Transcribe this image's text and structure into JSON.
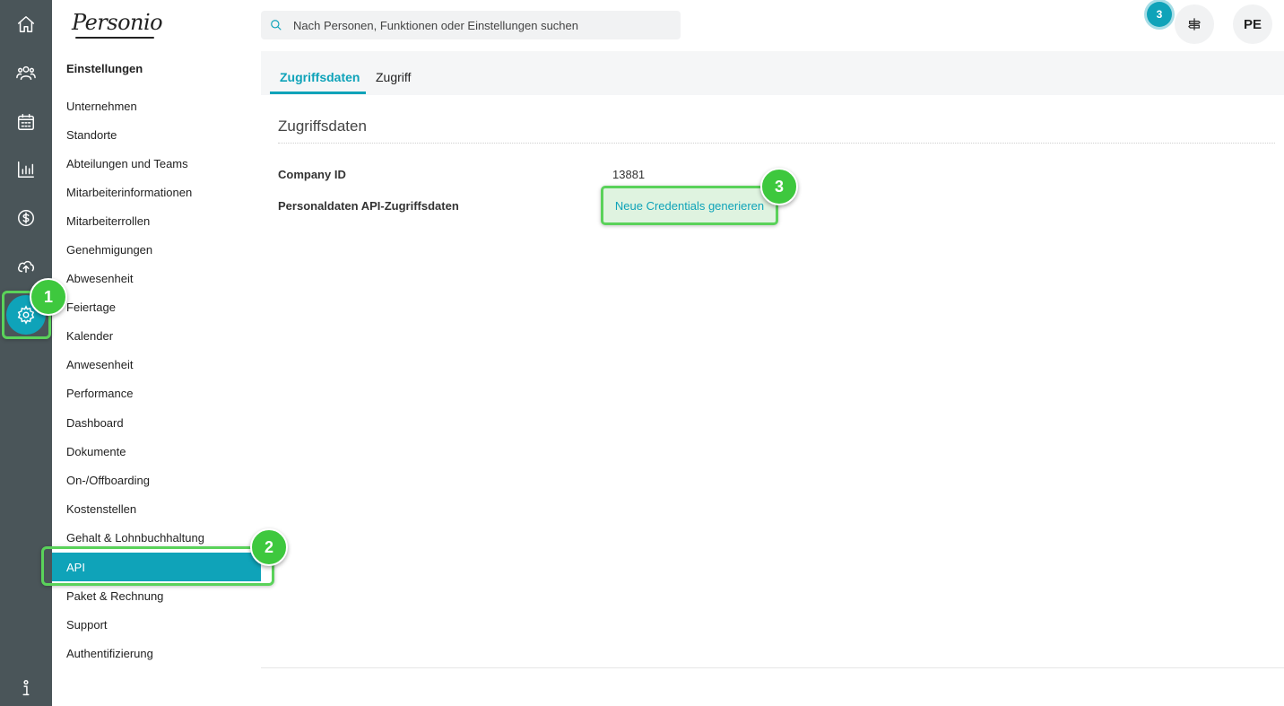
{
  "header": {
    "logo_text": "Personio",
    "search_placeholder": "Nach Personen, Funktionen oder Einstellungen suchen",
    "notification_count": "3",
    "avatar_initials": "PE"
  },
  "rail": {
    "icons": [
      "home-icon",
      "people-icon",
      "calendar-icon",
      "chart-icon",
      "dollar-icon",
      "cloud-upload-icon",
      "gear-icon",
      "info-icon"
    ]
  },
  "settings_nav": {
    "title": "Einstellungen",
    "items": [
      {
        "label": "Unternehmen"
      },
      {
        "label": "Standorte"
      },
      {
        "label": "Abteilungen und Teams"
      },
      {
        "label": "Mitarbeiterinformationen"
      },
      {
        "label": "Mitarbeiterrollen"
      },
      {
        "label": "Genehmigungen"
      },
      {
        "label": "Abwesenheit"
      },
      {
        "label": "Feiertage"
      },
      {
        "label": "Kalender"
      },
      {
        "label": "Anwesenheit"
      },
      {
        "label": "Performance"
      },
      {
        "label": "Dashboard"
      },
      {
        "label": "Dokumente"
      },
      {
        "label": "On-/Offboarding"
      },
      {
        "label": "Kostenstellen"
      },
      {
        "label": "Gehalt & Lohnbuchhaltung"
      },
      {
        "label": "API",
        "active": true
      },
      {
        "label": "Paket & Rechnung"
      },
      {
        "label": "Support"
      },
      {
        "label": "Authentifizierung"
      }
    ]
  },
  "main": {
    "tabs": [
      {
        "label": "Zugriffsdaten",
        "active": true
      },
      {
        "label": "Zugriff"
      }
    ],
    "section_title": "Zugriffsdaten",
    "fields": {
      "company_id_label": "Company ID",
      "company_id_value": "13881",
      "api_label": "Personaldaten API-Zugriffsdaten",
      "api_button": "Neue Credentials generieren"
    }
  },
  "callouts": [
    "1",
    "2",
    "3"
  ],
  "colors": {
    "accent": "#0fa3b9",
    "rail": "#4a5559",
    "highlight": "#5ad25a"
  }
}
